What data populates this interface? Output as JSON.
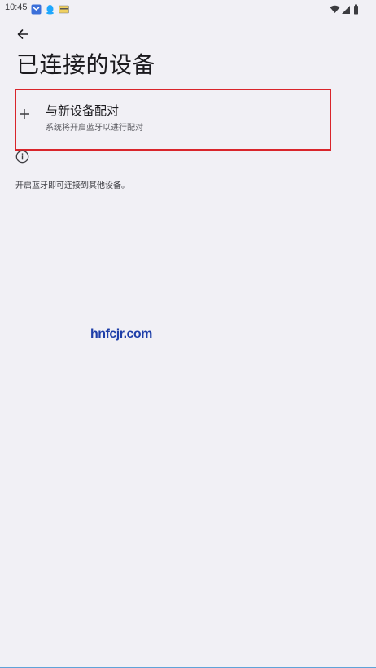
{
  "status_bar": {
    "time": "10:45",
    "icons": [
      "app-notification-icon",
      "qq-icon",
      "card-icon",
      "wifi-icon",
      "signal-icon",
      "battery-icon"
    ]
  },
  "header": {
    "back_icon": "arrow-back-icon",
    "title": "已连接的设备"
  },
  "pair_new_device": {
    "icon": "plus-icon",
    "title": "与新设备配对",
    "subtitle": "系统将开启蓝牙以进行配对"
  },
  "info": {
    "icon": "info-icon",
    "text": "开启蓝牙即可连接到其他设备。"
  },
  "watermark": {
    "text": "hnfcjr.com"
  },
  "colors": {
    "background": "#f1f0f5",
    "highlight_border": "#d9252b",
    "watermark": "#1e3ea8"
  }
}
